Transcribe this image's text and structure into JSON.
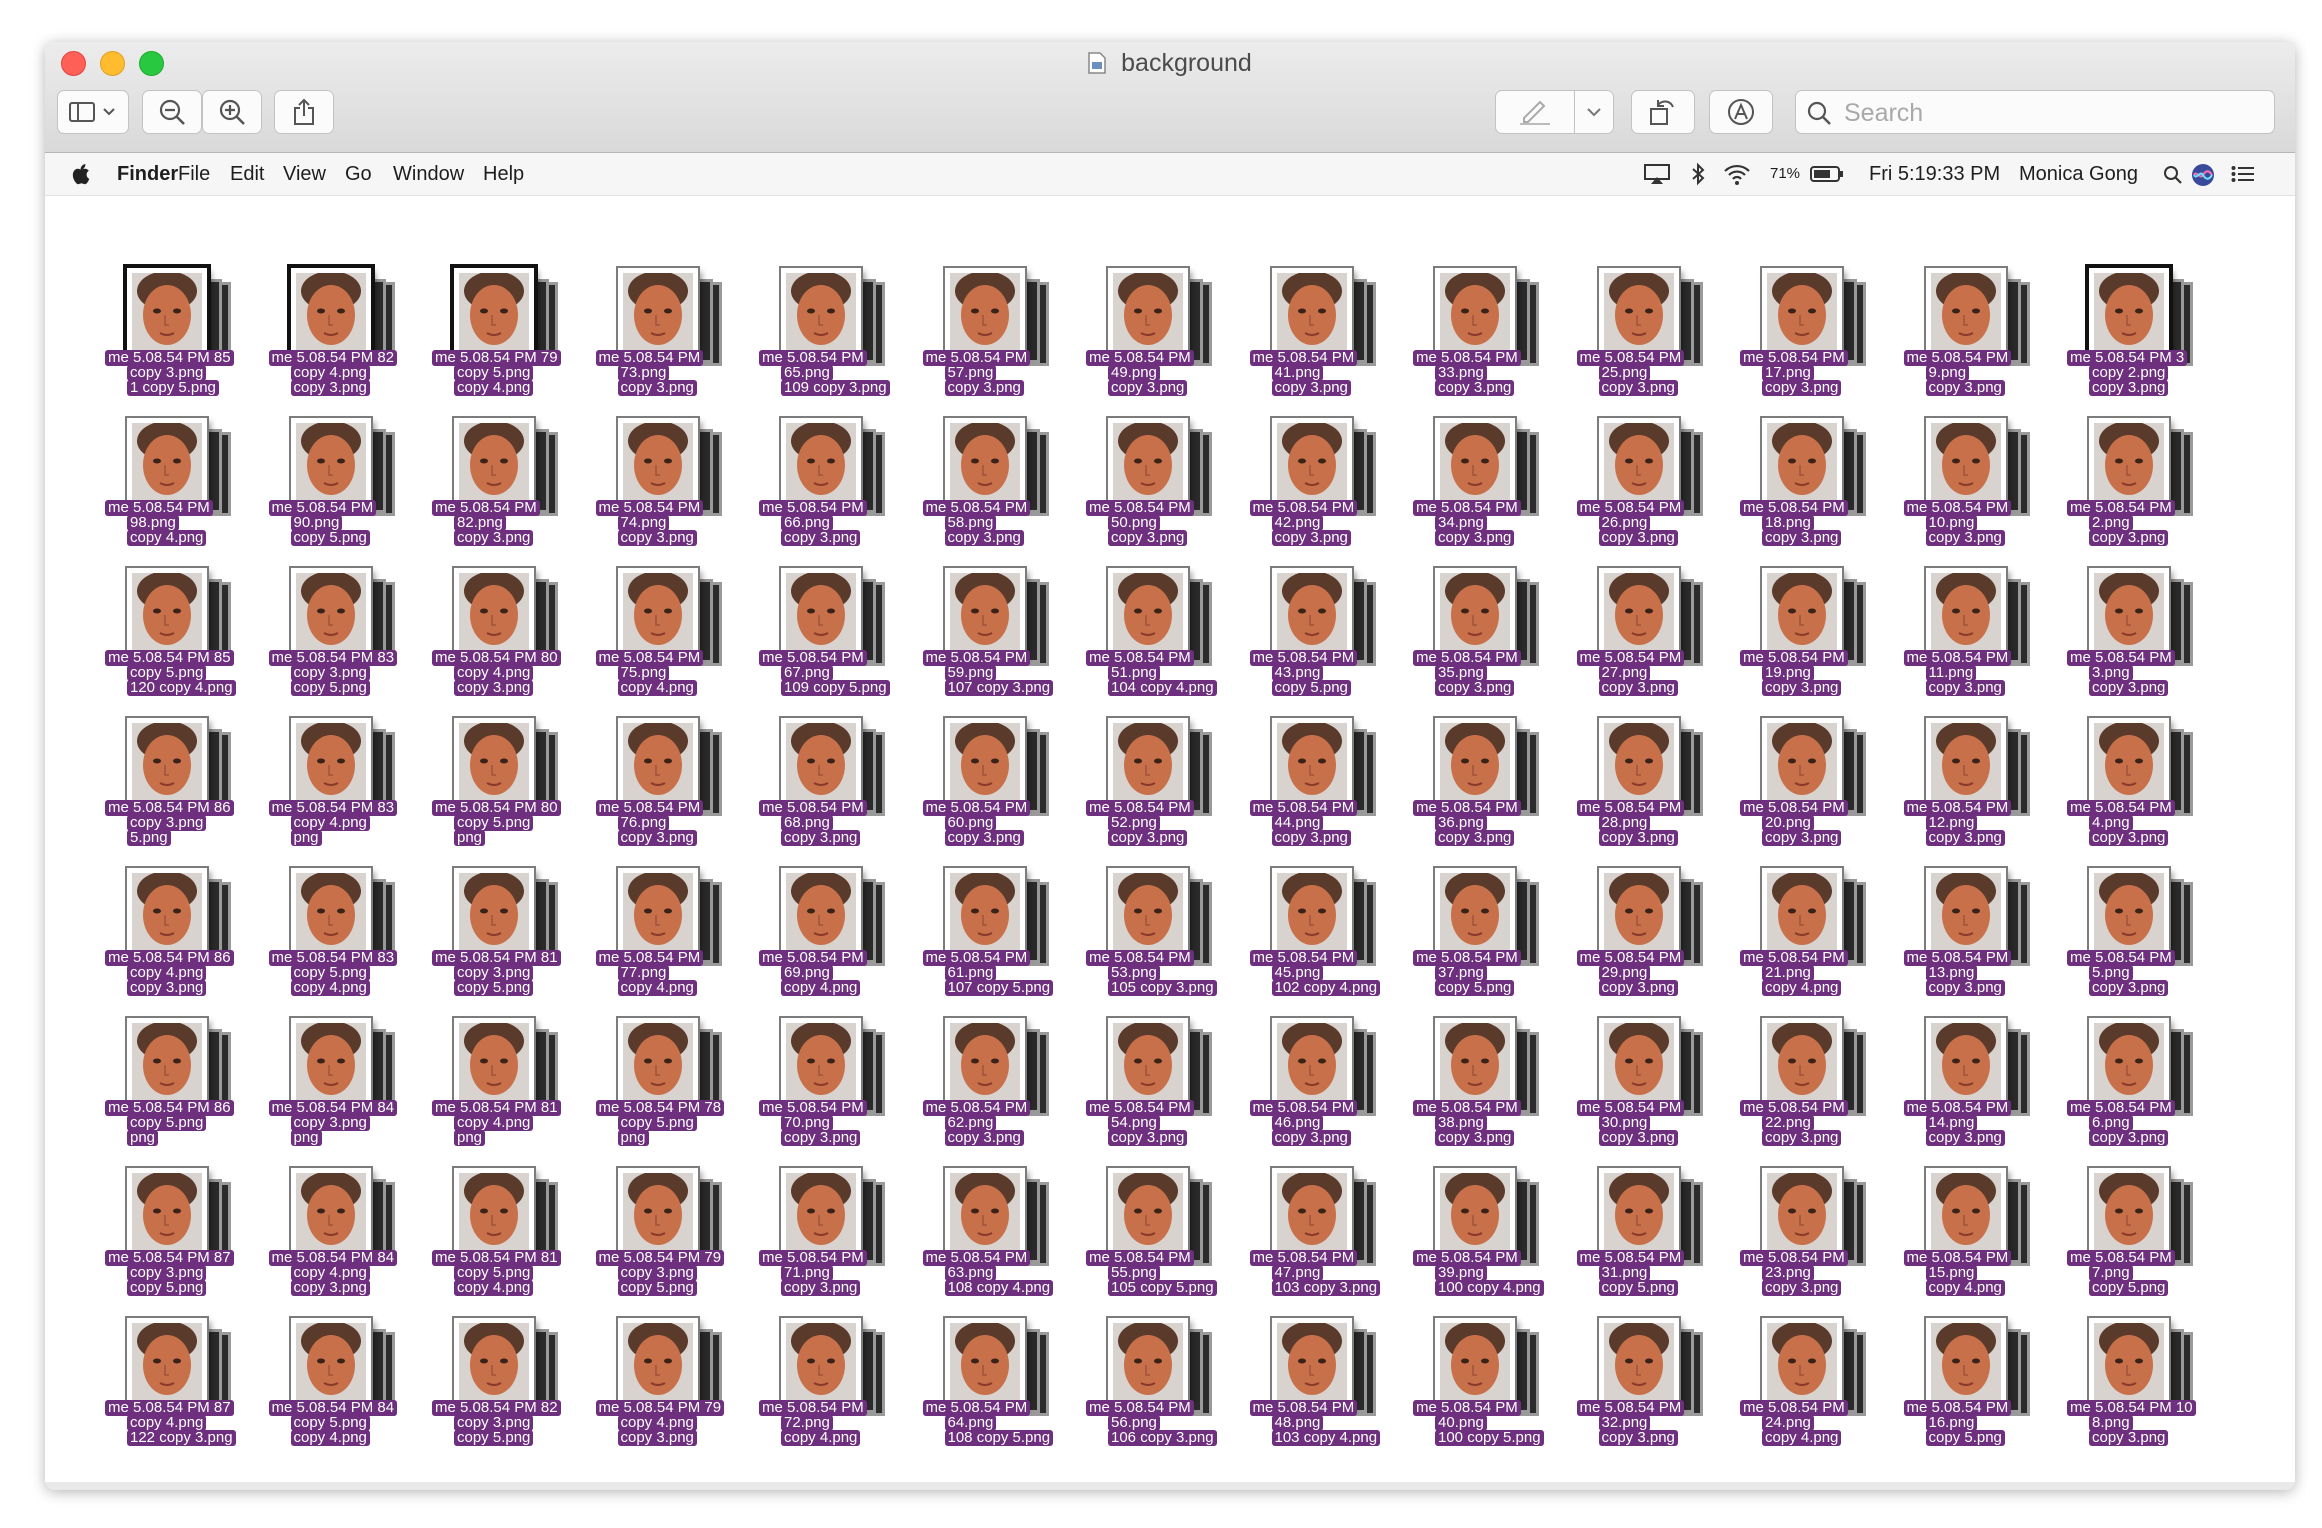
{
  "window": {
    "title": "background"
  },
  "toolbar": {
    "sidebar_icon": "sidebar-icon",
    "zoom_out_icon": "zoom-out-icon",
    "zoom_in_icon": "zoom-in-icon",
    "share_icon": "share-icon",
    "markup_icon": "pen-icon",
    "rotate_icon": "rotate-icon",
    "annotate_icon": "markup-circle-icon",
    "search_placeholder": "Search"
  },
  "menubar": {
    "app": "Finder",
    "items": [
      "File",
      "Edit",
      "View",
      "Go",
      "Window",
      "Help"
    ],
    "battery": "71%",
    "clock": "Fri 5:19:33 PM",
    "user": "Monica Gong"
  },
  "colors": {
    "label_bg": "#6e2f7e",
    "accent_red": "#fe5f57",
    "accent_yellow": "#febc2e",
    "accent_green": "#28c840"
  },
  "grid": {
    "rows": [
      [
        {
          "l1": "me 5.08.54 PM 85",
          "l2": "copy 3.png",
          "l3": "1 copy 5.png"
        },
        {
          "l1": "me 5.08.54 PM 82",
          "l2": "copy 4.png",
          "l3": "copy 3.png"
        },
        {
          "l1": "me 5.08.54 PM 79",
          "l2": "copy 5.png",
          "l3": "copy 4.png"
        },
        {
          "l1": "me 5.08.54 PM",
          "l2": "73.png",
          "l3": "copy 3.png"
        },
        {
          "l1": "me 5.08.54 PM",
          "l2": "65.png",
          "l3": "109 copy 3.png"
        },
        {
          "l1": "me 5.08.54 PM",
          "l2": "57.png",
          "l3": "copy 3.png"
        },
        {
          "l1": "me 5.08.54 PM",
          "l2": "49.png",
          "l3": "copy 3.png"
        },
        {
          "l1": "me 5.08.54 PM",
          "l2": "41.png",
          "l3": "copy 3.png"
        },
        {
          "l1": "me 5.08.54 PM",
          "l2": "33.png",
          "l3": "copy 3.png"
        },
        {
          "l1": "me 5.08.54 PM",
          "l2": "25.png",
          "l3": "copy 3.png"
        },
        {
          "l1": "me 5.08.54 PM",
          "l2": "17.png",
          "l3": "copy 3.png"
        },
        {
          "l1": "me 5.08.54 PM",
          "l2": "9.png",
          "l3": "copy 3.png"
        },
        {
          "l1": "me 5.08.54 PM 3",
          "l2": "copy 2.png",
          "l3": "copy 3.png"
        }
      ],
      [
        {
          "l1": "me 5.08.54 PM",
          "l2": "98.png",
          "l3": "copy 4.png"
        },
        {
          "l1": "me 5.08.54 PM",
          "l2": "90.png",
          "l3": "copy 5.png"
        },
        {
          "l1": "me 5.08.54 PM",
          "l2": "82.png",
          "l3": "copy 3.png"
        },
        {
          "l1": "me 5.08.54 PM",
          "l2": "74.png",
          "l3": "copy 3.png"
        },
        {
          "l1": "me 5.08.54 PM",
          "l2": "66.png",
          "l3": "copy 3.png"
        },
        {
          "l1": "me 5.08.54 PM",
          "l2": "58.png",
          "l3": "copy 3.png"
        },
        {
          "l1": "me 5.08.54 PM",
          "l2": "50.png",
          "l3": "copy 3.png"
        },
        {
          "l1": "me 5.08.54 PM",
          "l2": "42.png",
          "l3": "copy 3.png"
        },
        {
          "l1": "me 5.08.54 PM",
          "l2": "34.png",
          "l3": "copy 3.png"
        },
        {
          "l1": "me 5.08.54 PM",
          "l2": "26.png",
          "l3": "copy 3.png"
        },
        {
          "l1": "me 5.08.54 PM",
          "l2": "18.png",
          "l3": "copy 3.png"
        },
        {
          "l1": "me 5.08.54 PM",
          "l2": "10.png",
          "l3": "copy 3.png"
        },
        {
          "l1": "me 5.08.54 PM",
          "l2": "2.png",
          "l3": "copy 3.png"
        }
      ],
      [
        {
          "l1": "me 5.08.54 PM 85",
          "l2": "copy 5.png",
          "l3": "120 copy 4.png"
        },
        {
          "l1": "me 5.08.54 PM 83",
          "l2": "copy 3.png",
          "l3": "copy 5.png"
        },
        {
          "l1": "me 5.08.54 PM 80",
          "l2": "copy 4.png",
          "l3": "copy 3.png"
        },
        {
          "l1": "me 5.08.54 PM",
          "l2": "75.png",
          "l3": "copy 4.png"
        },
        {
          "l1": "me 5.08.54 PM",
          "l2": "67.png",
          "l3": "109 copy 5.png"
        },
        {
          "l1": "me 5.08.54 PM",
          "l2": "59.png",
          "l3": "107 copy 3.png"
        },
        {
          "l1": "me 5.08.54 PM",
          "l2": "51.png",
          "l3": "104 copy 4.png"
        },
        {
          "l1": "me 5.08.54 PM",
          "l2": "43.png",
          "l3": "copy 5.png"
        },
        {
          "l1": "me 5.08.54 PM",
          "l2": "35.png",
          "l3": "copy 3.png"
        },
        {
          "l1": "me 5.08.54 PM",
          "l2": "27.png",
          "l3": "copy 3.png"
        },
        {
          "l1": "me 5.08.54 PM",
          "l2": "19.png",
          "l3": "copy 3.png"
        },
        {
          "l1": "me 5.08.54 PM",
          "l2": "11.png",
          "l3": "copy 3.png"
        },
        {
          "l1": "me 5.08.54 PM",
          "l2": "3.png",
          "l3": "copy 3.png"
        }
      ],
      [
        {
          "l1": "me 5.08.54 PM 86",
          "l2": "copy 3.png",
          "l3": "5.png"
        },
        {
          "l1": "me 5.08.54 PM 83",
          "l2": "copy 4.png",
          "l3": "png"
        },
        {
          "l1": "me 5.08.54 PM 80",
          "l2": "copy 5.png",
          "l3": "png"
        },
        {
          "l1": "me 5.08.54 PM",
          "l2": "76.png",
          "l3": "copy 3.png"
        },
        {
          "l1": "me 5.08.54 PM",
          "l2": "68.png",
          "l3": "copy 3.png"
        },
        {
          "l1": "me 5.08.54 PM",
          "l2": "60.png",
          "l3": "copy 3.png"
        },
        {
          "l1": "me 5.08.54 PM",
          "l2": "52.png",
          "l3": "copy 3.png"
        },
        {
          "l1": "me 5.08.54 PM",
          "l2": "44.png",
          "l3": "copy 3.png"
        },
        {
          "l1": "me 5.08.54 PM",
          "l2": "36.png",
          "l3": "copy 3.png"
        },
        {
          "l1": "me 5.08.54 PM",
          "l2": "28.png",
          "l3": "copy 3.png"
        },
        {
          "l1": "me 5.08.54 PM",
          "l2": "20.png",
          "l3": "copy 3.png"
        },
        {
          "l1": "me 5.08.54 PM",
          "l2": "12.png",
          "l3": "copy 3.png"
        },
        {
          "l1": "me 5.08.54 PM",
          "l2": "4.png",
          "l3": "copy 3.png"
        }
      ],
      [
        {
          "l1": "me 5.08.54 PM 86",
          "l2": "copy 4.png",
          "l3": "copy 3.png"
        },
        {
          "l1": "me 5.08.54 PM 83",
          "l2": "copy 5.png",
          "l3": "copy 4.png"
        },
        {
          "l1": "me 5.08.54 PM 81",
          "l2": "copy 3.png",
          "l3": "copy 5.png"
        },
        {
          "l1": "me 5.08.54 PM",
          "l2": "77.png",
          "l3": "copy 4.png"
        },
        {
          "l1": "me 5.08.54 PM",
          "l2": "69.png",
          "l3": "copy 4.png"
        },
        {
          "l1": "me 5.08.54 PM",
          "l2": "61.png",
          "l3": "107 copy 5.png"
        },
        {
          "l1": "me 5.08.54 PM",
          "l2": "53.png",
          "l3": "105 copy 3.png"
        },
        {
          "l1": "me 5.08.54 PM",
          "l2": "45.png",
          "l3": "102 copy 4.png"
        },
        {
          "l1": "me 5.08.54 PM",
          "l2": "37.png",
          "l3": "copy 5.png"
        },
        {
          "l1": "me 5.08.54 PM",
          "l2": "29.png",
          "l3": "copy 3.png"
        },
        {
          "l1": "me 5.08.54 PM",
          "l2": "21.png",
          "l3": "copy 4.png"
        },
        {
          "l1": "me 5.08.54 PM",
          "l2": "13.png",
          "l3": "copy 3.png"
        },
        {
          "l1": "me 5.08.54 PM",
          "l2": "5.png",
          "l3": "copy 3.png"
        }
      ],
      [
        {
          "l1": "me 5.08.54 PM 86",
          "l2": "copy 5.png",
          "l3": "png"
        },
        {
          "l1": "me 5.08.54 PM 84",
          "l2": "copy 3.png",
          "l3": "png"
        },
        {
          "l1": "me 5.08.54 PM 81",
          "l2": "copy 4.png",
          "l3": "png"
        },
        {
          "l1": "me 5.08.54 PM 78",
          "l2": "copy 5.png",
          "l3": "png"
        },
        {
          "l1": "me 5.08.54 PM",
          "l2": "70.png",
          "l3": "copy 3.png"
        },
        {
          "l1": "me 5.08.54 PM",
          "l2": "62.png",
          "l3": "copy 3.png"
        },
        {
          "l1": "me 5.08.54 PM",
          "l2": "54.png",
          "l3": "copy 3.png"
        },
        {
          "l1": "me 5.08.54 PM",
          "l2": "46.png",
          "l3": "copy 3.png"
        },
        {
          "l1": "me 5.08.54 PM",
          "l2": "38.png",
          "l3": "copy 3.png"
        },
        {
          "l1": "me 5.08.54 PM",
          "l2": "30.png",
          "l3": "copy 3.png"
        },
        {
          "l1": "me 5.08.54 PM",
          "l2": "22.png",
          "l3": "copy 3.png"
        },
        {
          "l1": "me 5.08.54 PM",
          "l2": "14.png",
          "l3": "copy 3.png"
        },
        {
          "l1": "me 5.08.54 PM",
          "l2": "6.png",
          "l3": "copy 3.png"
        }
      ],
      [
        {
          "l1": "me 5.08.54 PM 87",
          "l2": "copy 3.png",
          "l3": "copy 5.png"
        },
        {
          "l1": "me 5.08.54 PM 84",
          "l2": "copy 4.png",
          "l3": "copy 3.png"
        },
        {
          "l1": "me 5.08.54 PM 81",
          "l2": "copy 5.png",
          "l3": "copy 4.png"
        },
        {
          "l1": "me 5.08.54 PM 79",
          "l2": "copy 3.png",
          "l3": "copy 5.png"
        },
        {
          "l1": "me 5.08.54 PM",
          "l2": "71.png",
          "l3": "copy 3.png"
        },
        {
          "l1": "me 5.08.54 PM",
          "l2": "63.png",
          "l3": "108 copy 4.png"
        },
        {
          "l1": "me 5.08.54 PM",
          "l2": "55.png",
          "l3": "105 copy 5.png"
        },
        {
          "l1": "me 5.08.54 PM",
          "l2": "47.png",
          "l3": "103 copy 3.png"
        },
        {
          "l1": "me 5.08.54 PM",
          "l2": "39.png",
          "l3": "100 copy 4.png"
        },
        {
          "l1": "me 5.08.54 PM",
          "l2": "31.png",
          "l3": "copy 5.png"
        },
        {
          "l1": "me 5.08.54 PM",
          "l2": "23.png",
          "l3": "copy 3.png"
        },
        {
          "l1": "me 5.08.54 PM",
          "l2": "15.png",
          "l3": "copy 4.png"
        },
        {
          "l1": "me 5.08.54 PM",
          "l2": "7.png",
          "l3": "copy 5.png"
        }
      ],
      [
        {
          "l1": "me 5.08.54 PM 87",
          "l2": "copy 4.png",
          "l3": "122 copy 3.png"
        },
        {
          "l1": "me 5.08.54 PM 84",
          "l2": "copy 5.png",
          "l3": "copy 4.png"
        },
        {
          "l1": "me 5.08.54 PM 82",
          "l2": "copy 3.png",
          "l3": "copy 5.png"
        },
        {
          "l1": "me 5.08.54 PM 79",
          "l2": "copy 4.png",
          "l3": "copy 3.png"
        },
        {
          "l1": "me 5.08.54 PM",
          "l2": "72.png",
          "l3": "copy 4.png"
        },
        {
          "l1": "me 5.08.54 PM",
          "l2": "64.png",
          "l3": "108 copy 5.png"
        },
        {
          "l1": "me 5.08.54 PM",
          "l2": "56.png",
          "l3": "106 copy 3.png"
        },
        {
          "l1": "me 5.08.54 PM",
          "l2": "48.png",
          "l3": "103 copy 4.png"
        },
        {
          "l1": "me 5.08.54 PM",
          "l2": "40.png",
          "l3": "100 copy 5.png"
        },
        {
          "l1": "me 5.08.54 PM",
          "l2": "32.png",
          "l3": "copy 3.png"
        },
        {
          "l1": "me 5.08.54 PM",
          "l2": "24.png",
          "l3": "copy 4.png"
        },
        {
          "l1": "me 5.08.54 PM",
          "l2": "16.png",
          "l3": "copy 5.png"
        },
        {
          "l1": "me 5.08.54 PM 10",
          "l2": "8.png",
          "l3": "copy 3.png"
        }
      ]
    ]
  }
}
